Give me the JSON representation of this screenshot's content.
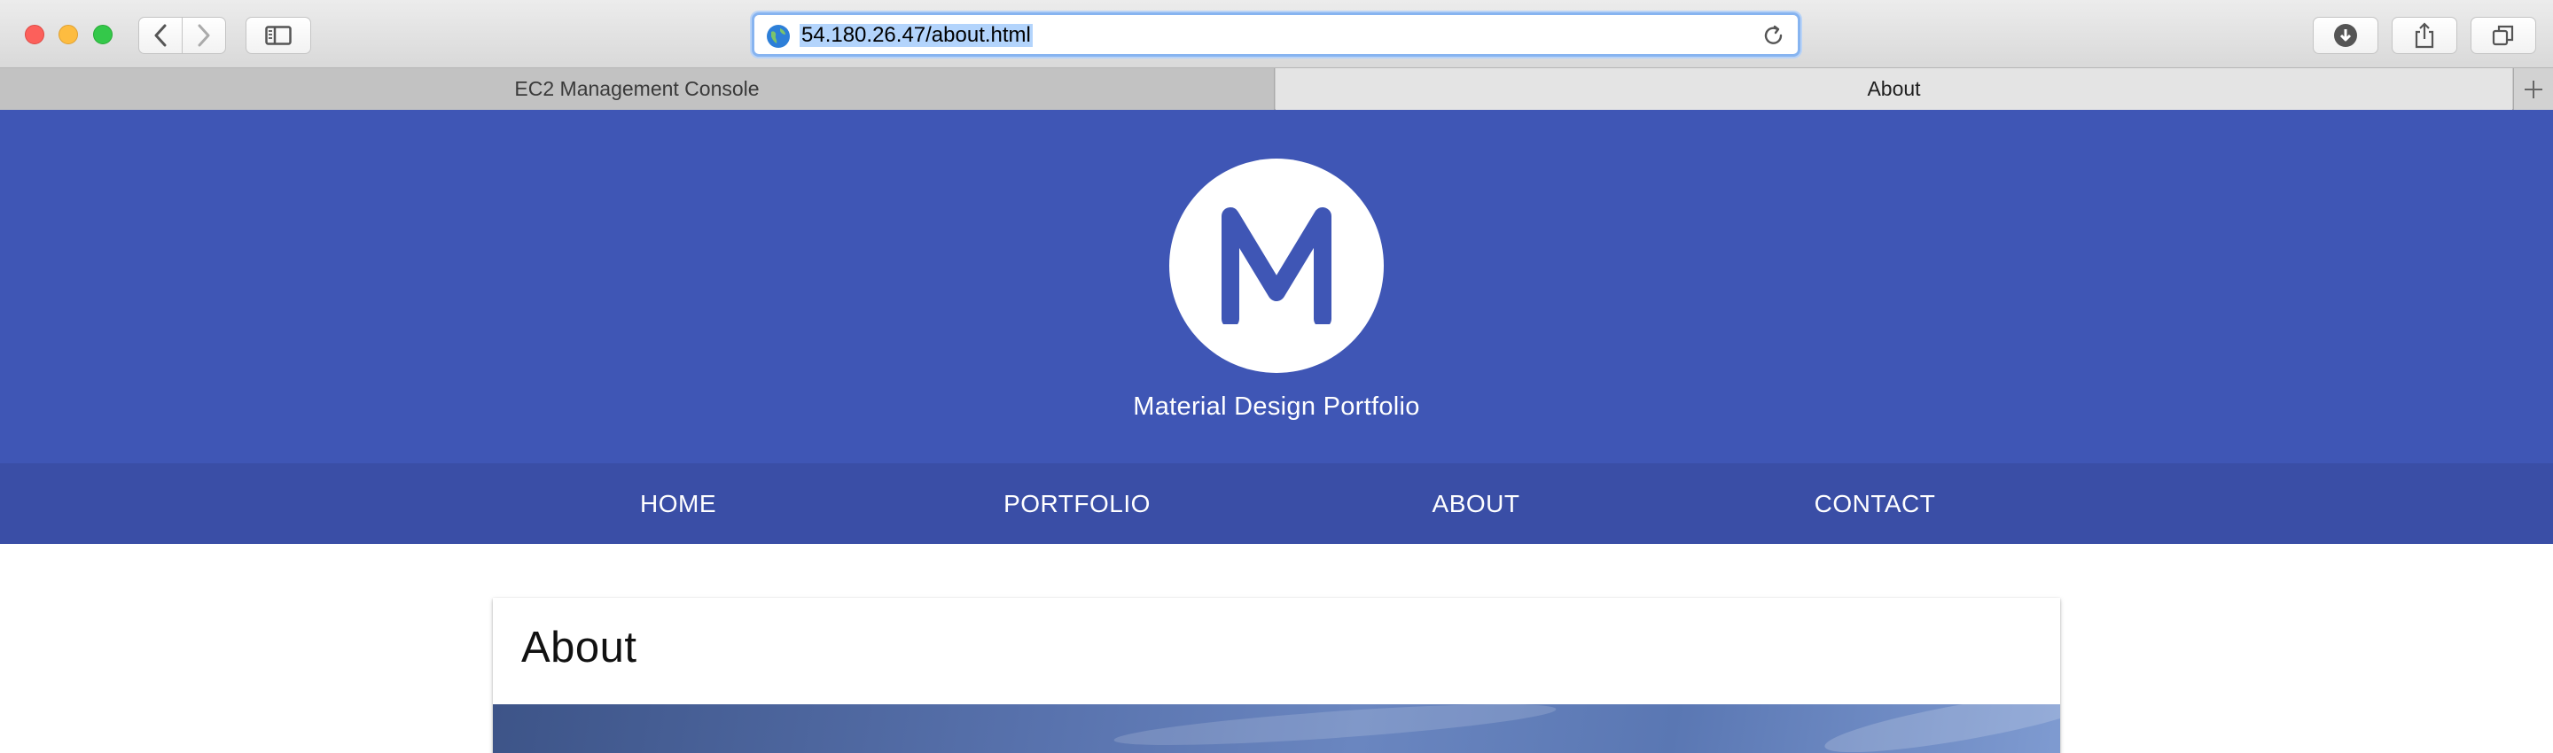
{
  "browser": {
    "url": "54.180.26.47/about.html",
    "tabs": [
      {
        "label": "EC2 Management Console",
        "active": false
      },
      {
        "label": "About",
        "active": true
      }
    ]
  },
  "header": {
    "logo_letter": "M",
    "site_title": "Material Design Portfolio"
  },
  "nav": {
    "items": [
      "HOME",
      "PORTFOLIO",
      "ABOUT",
      "CONTACT"
    ]
  },
  "card": {
    "title": "About"
  },
  "colors": {
    "primary": "#3f56b5",
    "nav_bg": "#3a4ea6",
    "url_highlight": "#b3d4fc"
  },
  "icons": [
    "globe-icon",
    "reload-icon",
    "back-icon",
    "forward-icon",
    "sidebar-icon",
    "download-icon",
    "share-icon",
    "tabs-overview-icon",
    "plus-icon"
  ]
}
